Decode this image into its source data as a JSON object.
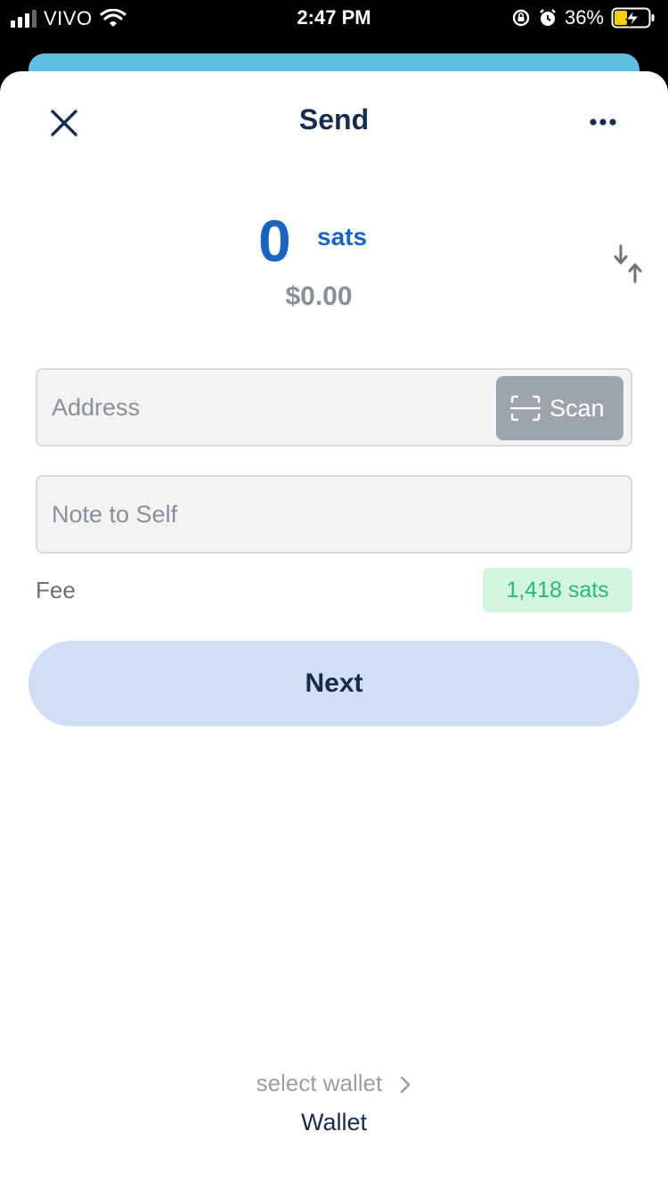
{
  "status_bar": {
    "carrier": "VIVO",
    "time": "2:47 PM",
    "battery_percent": "36%"
  },
  "header": {
    "title": "Send"
  },
  "amount": {
    "value": "0",
    "unit": "sats",
    "fiat": "$0.00"
  },
  "address": {
    "placeholder": "Address",
    "scan_label": "Scan"
  },
  "note": {
    "placeholder": "Note to Self"
  },
  "fee": {
    "label": "Fee",
    "value": "1,418 sats"
  },
  "next_label": "Next",
  "wallet": {
    "select_label": "select wallet",
    "name": "Wallet"
  },
  "colors": {
    "accent_blue": "#1a63c3",
    "navy": "#172b4d",
    "button_bg": "#d1ddf4",
    "fee_green": "#2bb57f",
    "fee_bg": "#d3f5df",
    "scan_bg": "#9ea4ae",
    "peek_card": "#5fc0e4"
  }
}
